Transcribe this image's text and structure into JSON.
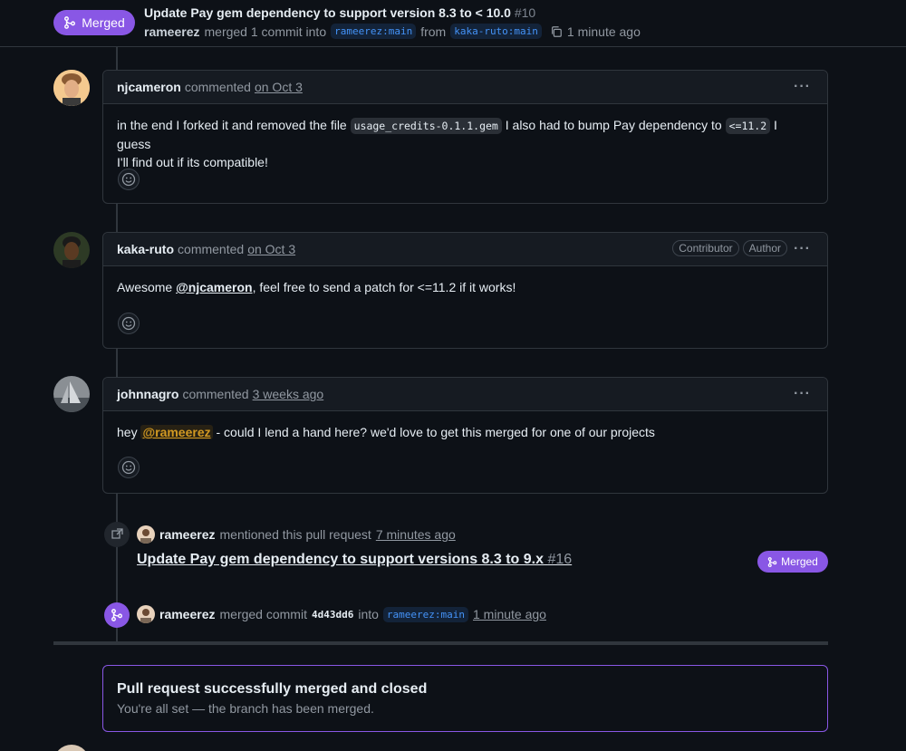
{
  "header": {
    "state": "Merged",
    "title": "Update Pay gem dependency to support version 8.3 to < 10.0",
    "number": "#10",
    "author": "rameerez",
    "merged_text": "merged 1 commit into",
    "base_branch": "rameerez:main",
    "from_text": "from",
    "head_branch": "kaka-ruto:main",
    "time": "1 minute ago"
  },
  "comments": [
    {
      "author": "njcameron",
      "action": "commented",
      "time": "on Oct 3",
      "body_1": "in the end I forked it and removed the file",
      "code_1": "usage_credits-0.1.1.gem",
      "body_2": "I also had to bump Pay dependency to",
      "code_2": "<=11.2",
      "body_3": "I guess",
      "body_4": "I'll find out if its compatible!"
    },
    {
      "author": "kaka-ruto",
      "action": "commented",
      "time": "on Oct 3",
      "labels": [
        "Contributor",
        "Author"
      ],
      "body_1": "Awesome",
      "mention": "@njcameron",
      "body_2": ", feel free to send a patch for <=11.2 if it works!"
    },
    {
      "author": "johnnagro",
      "action": "commented",
      "time": "3 weeks ago",
      "body_1": "hey",
      "mention": "@rameerez",
      "body_2": "- could I lend a hand here? we'd love to get this merged for one of our projects"
    }
  ],
  "events": {
    "mention": {
      "author": "rameerez",
      "text": "mentioned this pull request",
      "time": "7 minutes ago",
      "ref_title": "Update Pay gem dependency to support versions 8.3 to 9.x",
      "ref_number": "#16",
      "ref_state": "Merged"
    },
    "merge": {
      "author": "rameerez",
      "text": "merged commit",
      "commit": "4d43dd6",
      "into": "into",
      "branch": "rameerez:main",
      "time": "1 minute ago"
    }
  },
  "merged_box": {
    "heading": "Pull request successfully merged and closed",
    "subtext": "You're all set — the branch has been merged."
  },
  "colors": {
    "merged": "#8957e5",
    "background": "#0d1117",
    "mention_highlight": "#d29922",
    "branch": "#4493f8"
  }
}
